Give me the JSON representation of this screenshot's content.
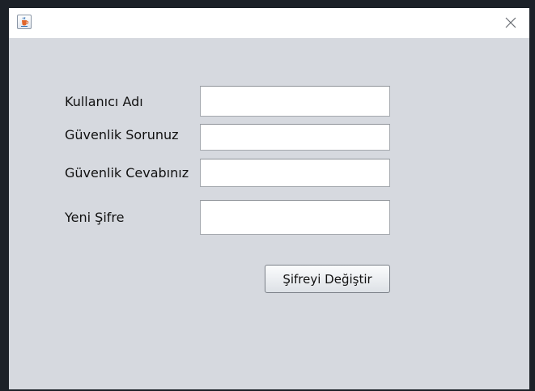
{
  "window": {
    "app_icon": "java-coffee-cup-icon",
    "close_icon": "close-x-icon"
  },
  "form": {
    "username_label": "Kullanıcı Adı",
    "username_value": "",
    "security_question_label": "Güvenlik Sorunuz",
    "security_question_value": "",
    "security_answer_label": "Güvenlik Cevabınız",
    "security_answer_value": "",
    "new_password_label": "Yeni Şifre",
    "new_password_value": "",
    "change_password_button": "Şifreyi Değiştir"
  }
}
